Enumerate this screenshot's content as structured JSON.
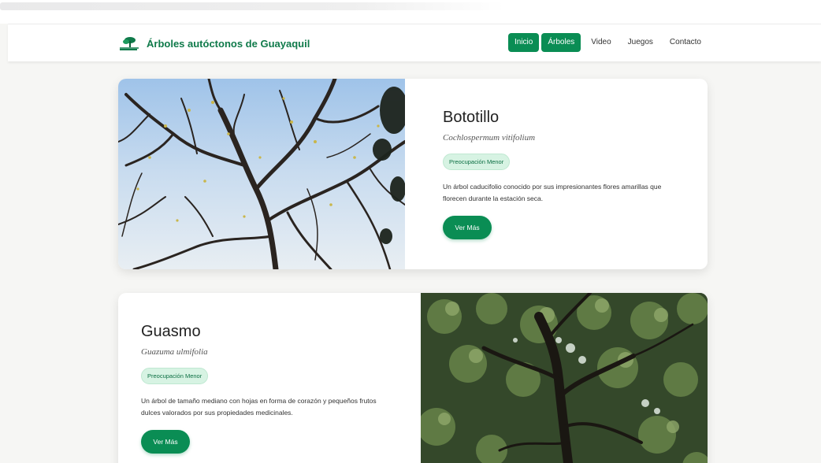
{
  "site": {
    "title": "Árboles autóctonos de Guayaquil",
    "logo_icon": "tree-logo-icon",
    "accent_color": "#0a8d54"
  },
  "nav": {
    "items": [
      {
        "label": "Inicio",
        "active": true
      },
      {
        "label": "Árboles",
        "active": true
      },
      {
        "label": "Video",
        "active": false
      },
      {
        "label": "Juegos",
        "active": false
      },
      {
        "label": "Contacto",
        "active": false
      }
    ]
  },
  "trees": [
    {
      "name": "Bototillo",
      "scientific_name": "Cochlospermum vitifolium",
      "status": "Preocupación Menor",
      "description": "Un árbol caducifolio conocido por sus impresionantes flores amarillas que florecen durante la estación seca.",
      "button_label": "Ver Más",
      "image": "bare-tree-branches-photo"
    },
    {
      "name": "Guasmo",
      "scientific_name": "Guazuma ulmifolia",
      "status": "Preocupación Menor",
      "description": "Un árbol de tamaño mediano con hojas en forma de corazón y pequeños frutos dulces valorados por sus propiedades medicinales.",
      "button_label": "Ver Más",
      "image": "leafy-tree-canopy-photo"
    }
  ]
}
